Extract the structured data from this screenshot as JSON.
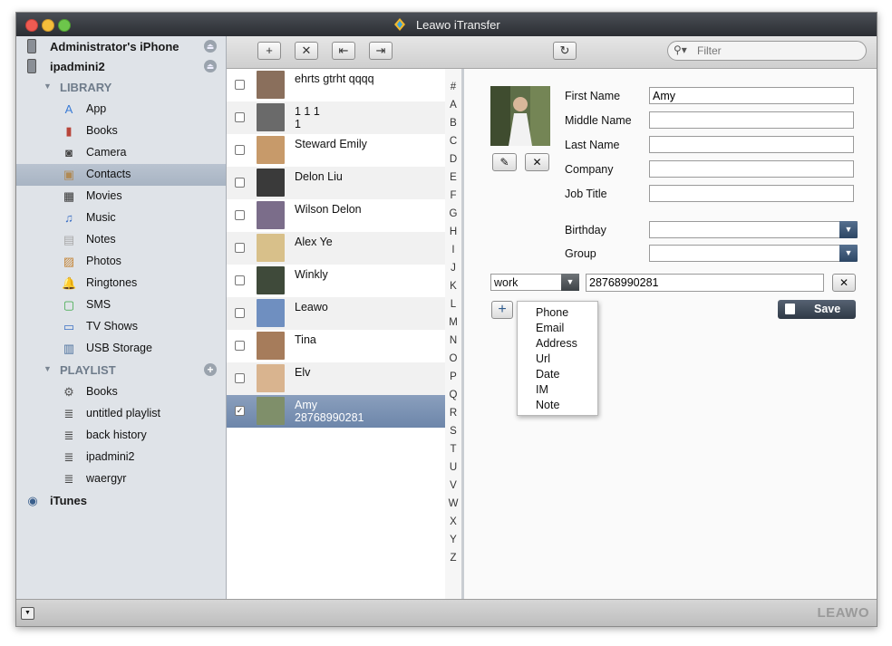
{
  "window": {
    "title": "Leawo iTransfer"
  },
  "sidebar": {
    "devices": [
      {
        "label": "Administrator's iPhone"
      },
      {
        "label": "ipadmini2"
      }
    ],
    "library": {
      "label": "LIBRARY",
      "items": [
        {
          "label": "App",
          "icon": "app-store-icon"
        },
        {
          "label": "Books",
          "icon": "book-icon"
        },
        {
          "label": "Camera",
          "icon": "camera-icon"
        },
        {
          "label": "Contacts",
          "icon": "contacts-icon",
          "selected": true
        },
        {
          "label": "Movies",
          "icon": "film-icon"
        },
        {
          "label": "Music",
          "icon": "music-note-icon"
        },
        {
          "label": "Notes",
          "icon": "notes-icon"
        },
        {
          "label": "Photos",
          "icon": "photo-icon"
        },
        {
          "label": "Ringtones",
          "icon": "bell-icon"
        },
        {
          "label": "SMS",
          "icon": "message-icon"
        },
        {
          "label": "TV Shows",
          "icon": "tv-icon"
        },
        {
          "label": "USB Storage",
          "icon": "usb-storage-icon"
        }
      ]
    },
    "playlist": {
      "label": "PLAYLIST",
      "items": [
        {
          "label": "Books",
          "icon": "gear-icon"
        },
        {
          "label": "untitled playlist",
          "icon": "playlist-icon"
        },
        {
          "label": "back history",
          "icon": "playlist-icon"
        },
        {
          "label": "ipadmini2",
          "icon": "playlist-icon"
        },
        {
          "label": "waergyr",
          "icon": "playlist-icon"
        }
      ]
    },
    "itunes": {
      "label": "iTunes"
    }
  },
  "toolbar": {
    "add_glyph": "+",
    "delete_glyph": "✕",
    "import_glyph": "⇤",
    "export_glyph": "⇥",
    "refresh_glyph": "↻",
    "search_placeholder": "Filter"
  },
  "contacts": [
    {
      "line1": "ehrts gtrht qqqq",
      "line2": "",
      "checked": false,
      "thumb": "#8a6f5c"
    },
    {
      "line1": "1 1 1",
      "line2": "1",
      "checked": false,
      "thumb": "#6a6a6a"
    },
    {
      "line1": "Steward Emily",
      "line2": "",
      "checked": false,
      "thumb": "#c79a6a"
    },
    {
      "line1": "Delon Liu",
      "line2": "",
      "checked": false,
      "thumb": "#3a3a3a"
    },
    {
      "line1": "Wilson Delon",
      "line2": "",
      "checked": false,
      "thumb": "#7b6d8a"
    },
    {
      "line1": "Alex Ye",
      "line2": "",
      "checked": false,
      "thumb": "#d8c08a"
    },
    {
      "line1": "Winkly",
      "line2": "",
      "checked": false,
      "thumb": "#3f4a3a"
    },
    {
      "line1": "Leawo",
      "line2": "",
      "checked": false,
      "thumb": "#6f8fc0"
    },
    {
      "line1": "Tina",
      "line2": "",
      "checked": false,
      "thumb": "#a67c5b"
    },
    {
      "line1": "Elv",
      "line2": "",
      "checked": false,
      "thumb": "#d9b48f"
    },
    {
      "line1": "Amy",
      "line2": "28768990281",
      "checked": true,
      "thumb": "#7f8f6a",
      "selected": true
    }
  ],
  "alphabet": [
    "#",
    "A",
    "B",
    "C",
    "D",
    "E",
    "F",
    "G",
    "H",
    "I",
    "J",
    "K",
    "L",
    "M",
    "N",
    "O",
    "P",
    "Q",
    "R",
    "S",
    "T",
    "U",
    "V",
    "W",
    "X",
    "Y",
    "Z"
  ],
  "detail": {
    "fields": [
      {
        "label": "First Name",
        "value": "Amy"
      },
      {
        "label": "Middle Name",
        "value": ""
      },
      {
        "label": "Last Name",
        "value": ""
      },
      {
        "label": "Company",
        "value": ""
      },
      {
        "label": "Job Title",
        "value": ""
      }
    ],
    "birthday": {
      "label": "Birthday",
      "value": ""
    },
    "group": {
      "label": "Group",
      "value": ""
    },
    "phone": {
      "type": "work",
      "value": "28768990281"
    },
    "save_label": "Save",
    "add_menu": [
      "Phone",
      "Email",
      "Address",
      "Url",
      "Date",
      "IM",
      "Note"
    ]
  },
  "statusbar": {
    "brand": "LEAWO"
  }
}
